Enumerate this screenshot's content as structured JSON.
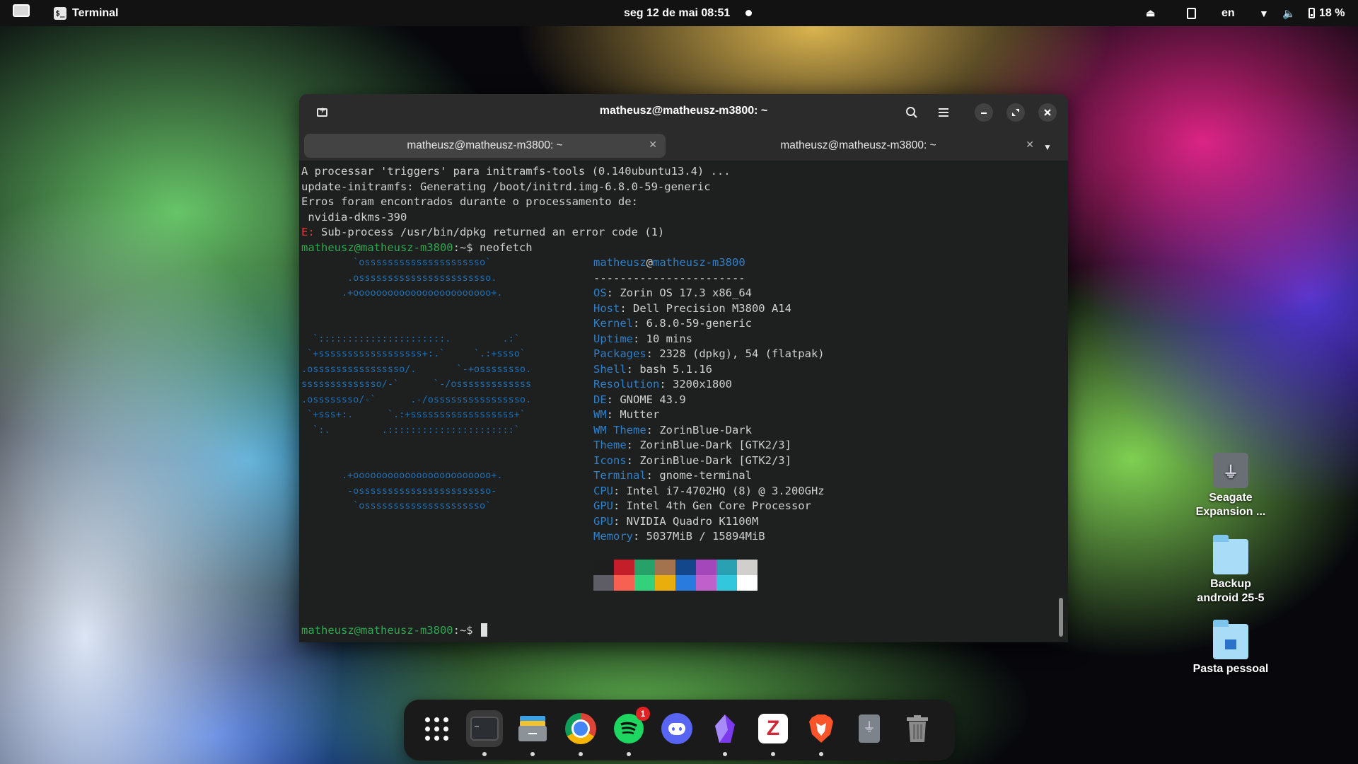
{
  "topbar": {
    "app_name": "Terminal",
    "clock": "seg 12 de mai  08:51",
    "language": "en",
    "battery": "18 %"
  },
  "window": {
    "title": "matheusz@matheusz-m3800: ~",
    "tabs": [
      {
        "label": "matheusz@matheusz-m3800: ~",
        "active": true
      },
      {
        "label": "matheusz@matheusz-m3800: ~",
        "active": false
      }
    ]
  },
  "terminal": {
    "lines": [
      "A processar 'triggers' para initramfs-tools (0.140ubuntu13.4) ...",
      "update-initramfs: Generating /boot/initrd.img-6.8.0-59-generic",
      "Erros foram encontrados durante o processamento de:",
      " nvidia-dkms-390"
    ],
    "error_prefix": "E:",
    "error_text": " Sub-process /usr/bin/dpkg returned an error code (1)",
    "prompt_user": "matheusz@matheusz-m3800",
    "prompt_suffix": ":~$ ",
    "command": "neofetch",
    "logo": [
      "         `osssssssssssssssssssso`",
      "        .osssssssssssssssssssssso.",
      "       .+oooooooooooooooooooooooo+.",
      "",
      "",
      "  `::::::::::::::::::::::.         .:`",
      " `+ssssssssssssssssss+:.`     `.:+ssso`",
      ".ossssssssssssssso/.       `-+ossssssso.",
      "ssssssssssssso/-`      `-/osssssssssssss",
      ".ossssssso/-`      .-/ossssssssssssssso.",
      " `+sss+:.      `.:+ssssssssssssssssss+`",
      "  `:.         .::::::::::::::::::::::`",
      "",
      "",
      "       .+oooooooooooooooooooooooo+.",
      "        -osssssssssssssssssssssso-",
      "         `osssssssssssssssssssso`"
    ],
    "info_user": "matheusz",
    "info_at": "@",
    "info_host": "matheusz-m3800",
    "separator": "-----------------------",
    "info": [
      {
        "k": "OS",
        "v": "Zorin OS 17.3 x86_64"
      },
      {
        "k": "Host",
        "v": "Dell Precision M3800 A14"
      },
      {
        "k": "Kernel",
        "v": "6.8.0-59-generic"
      },
      {
        "k": "Uptime",
        "v": "10 mins"
      },
      {
        "k": "Packages",
        "v": "2328 (dpkg), 54 (flatpak)"
      },
      {
        "k": "Shell",
        "v": "bash 5.1.16"
      },
      {
        "k": "Resolution",
        "v": "3200x1800"
      },
      {
        "k": "DE",
        "v": "GNOME 43.9"
      },
      {
        "k": "WM",
        "v": "Mutter"
      },
      {
        "k": "WM Theme",
        "v": "ZorinBlue-Dark"
      },
      {
        "k": "Theme",
        "v": "ZorinBlue-Dark [GTK2/3]"
      },
      {
        "k": "Icons",
        "v": "ZorinBlue-Dark [GTK2/3]"
      },
      {
        "k": "Terminal",
        "v": "gnome-terminal"
      },
      {
        "k": "CPU",
        "v": "Intel i7-4702HQ (8) @ 3.200GHz"
      },
      {
        "k": "GPU",
        "v": "Intel 4th Gen Core Processor"
      },
      {
        "k": "GPU",
        "v": "NVIDIA Quadro K1100M"
      },
      {
        "k": "Memory",
        "v": "5037MiB / 15894MiB"
      }
    ],
    "palette_row1": [
      "#1e1e1e",
      "#c41e2a",
      "#26a269",
      "#a2734c",
      "#12488b",
      "#a347ba",
      "#2aa1b3",
      "#d0cfcc"
    ],
    "palette_row2": [
      "#5e5c64",
      "#f66151",
      "#33d17a",
      "#e9ad0c",
      "#2a7bde",
      "#c061cb",
      "#33c7de",
      "#ffffff"
    ]
  },
  "desktop_icons": [
    {
      "label": "Seagate\nExpansion ...",
      "icon": "usb-drive-icon"
    },
    {
      "label": "Backup\nandroid 25-5",
      "icon": "folder-icon"
    },
    {
      "label": "Pasta pessoal",
      "icon": "home-folder-icon"
    }
  ],
  "dock": {
    "apps": [
      "app-grid",
      "terminal",
      "files",
      "chrome",
      "spotify",
      "discord",
      "obsidian",
      "zotero",
      "brave",
      "usb-drive",
      "trash"
    ],
    "spotify_badge": "1"
  }
}
